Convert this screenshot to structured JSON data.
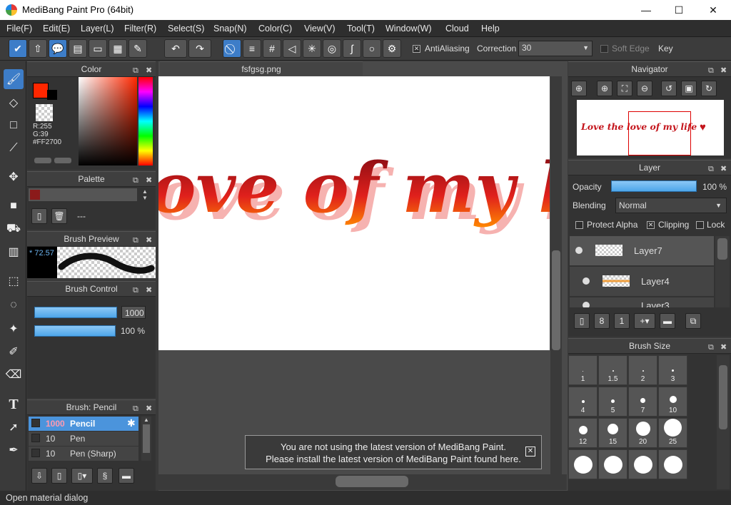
{
  "window": {
    "title": "MediBang Paint Pro (64bit)",
    "minimize": "—",
    "maximize": "☐",
    "close": "✕"
  },
  "menu": [
    "File(F)",
    "Edit(E)",
    "Layer(L)",
    "Filter(R)",
    "Select(S)",
    "Snap(N)",
    "Color(C)",
    "View(V)",
    "Tool(T)",
    "Window(W)",
    "Cloud",
    "Help"
  ],
  "toolbar": {
    "antialiasing": "AntiAliasing",
    "correction_label": "Correction",
    "correction_value": "30",
    "soft_edge": "Soft Edge",
    "key": "Key"
  },
  "color_panel": {
    "title": "Color",
    "r": "R:255",
    "g": "G:39",
    "hex": "#FF2700",
    "fg": "#ff2700"
  },
  "palette_panel": {
    "title": "Palette",
    "item": "---"
  },
  "brush_preview": {
    "title": "Brush Preview",
    "size": "* 72.57"
  },
  "brush_control": {
    "title": "Brush Control",
    "size": "1000",
    "opacity": "100 %"
  },
  "brush_list": {
    "title": "Brush: Pencil",
    "items": [
      {
        "size": "1000",
        "name": "Pencil"
      },
      {
        "size": "10",
        "name": "Pen"
      },
      {
        "size": "10",
        "name": "Pen (Sharp)"
      }
    ]
  },
  "document": {
    "tab": "fsfgsg.png",
    "canvas_text": "love of my lif",
    "nav_text": "Love the love of my life"
  },
  "navigator": {
    "title": "Navigator"
  },
  "layer_panel": {
    "title": "Layer",
    "opacity_label": "Opacity",
    "opacity_value": "100 %",
    "blending_label": "Blending",
    "blending_value": "Normal",
    "protect_alpha": "Protect Alpha",
    "clipping": "Clipping",
    "lock": "Lock",
    "layers": [
      "Layer7",
      "Layer4",
      "Layer3"
    ]
  },
  "brush_size": {
    "title": "Brush Size",
    "sizes": [
      "1",
      "1.5",
      "2",
      "3",
      "4",
      "5",
      "7",
      "10",
      "12",
      "15",
      "20",
      "25"
    ]
  },
  "notice": {
    "line1": "You are not using the latest version of MediBang Paint.",
    "line2": "Please install the latest version of MediBang Paint found here."
  },
  "status": "Open material dialog"
}
